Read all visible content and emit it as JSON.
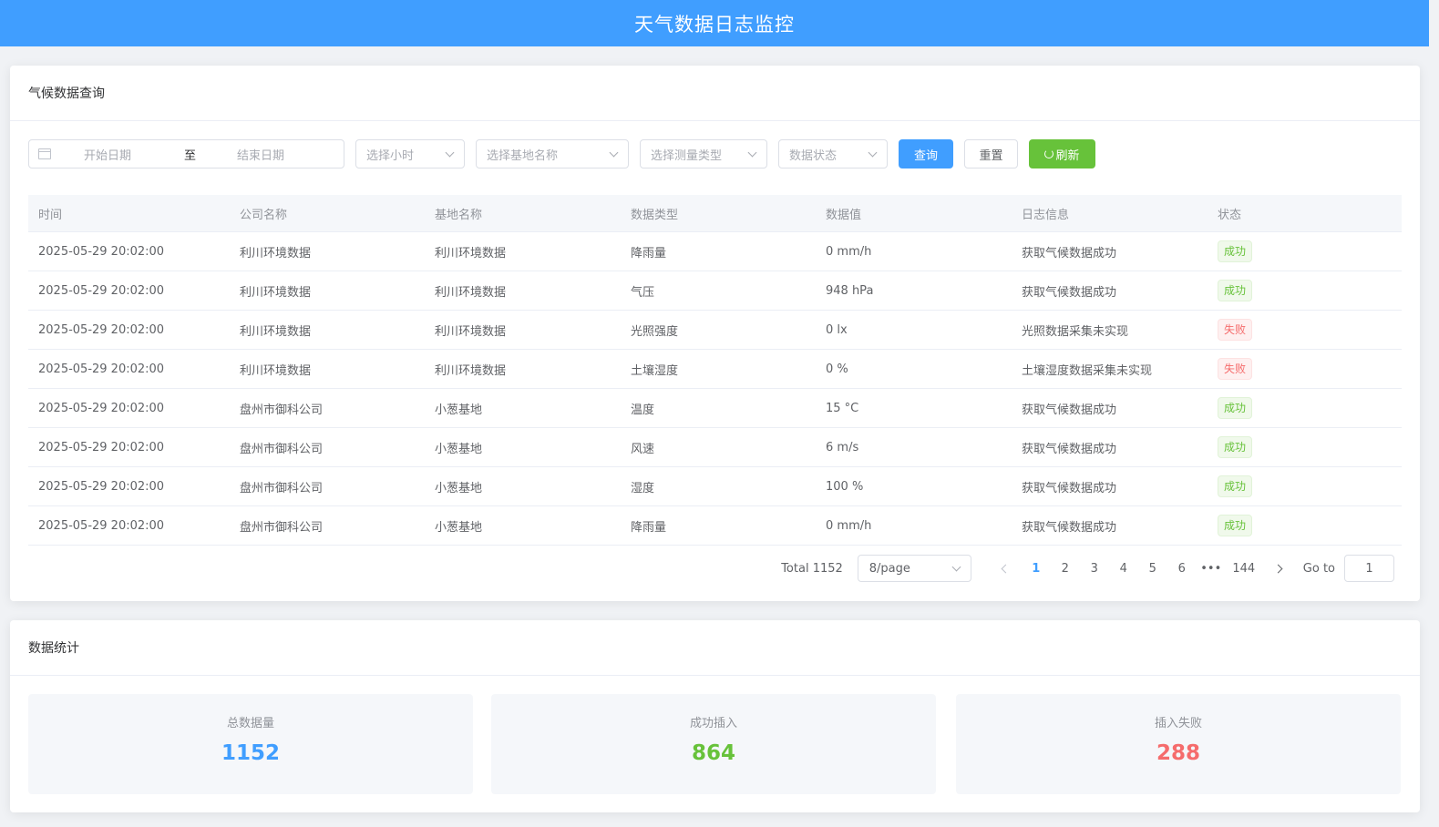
{
  "header": {
    "title": "天气数据日志监控"
  },
  "query": {
    "title": "气候数据查询",
    "filters": {
      "start_placeholder": "开始日期",
      "separator": "至",
      "end_placeholder": "结束日期",
      "hour_placeholder": "选择小时",
      "base_placeholder": "选择基地名称",
      "type_placeholder": "选择测量类型",
      "status_placeholder": "数据状态"
    },
    "buttons": {
      "query": "查询",
      "reset": "重置",
      "refresh": "刷新"
    },
    "table": {
      "headers": [
        "时间",
        "公司名称",
        "基地名称",
        "数据类型",
        "数据值",
        "日志信息",
        "状态"
      ],
      "rows": [
        [
          "2025-05-29 20:02:00",
          "利川环境数据",
          "利川环境数据",
          "降雨量",
          "0 mm/h",
          "获取气候数据成功",
          "成功"
        ],
        [
          "2025-05-29 20:02:00",
          "利川环境数据",
          "利川环境数据",
          "气压",
          "948 hPa",
          "获取气候数据成功",
          "成功"
        ],
        [
          "2025-05-29 20:02:00",
          "利川环境数据",
          "利川环境数据",
          "光照强度",
          "0 lx",
          "光照数据采集未实现",
          "失败"
        ],
        [
          "2025-05-29 20:02:00",
          "利川环境数据",
          "利川环境数据",
          "土壤湿度",
          "0 %",
          "土壤湿度数据采集未实现",
          "失败"
        ],
        [
          "2025-05-29 20:02:00",
          "盘州市御科公司",
          "小葱基地",
          "温度",
          "15 °C",
          "获取气候数据成功",
          "成功"
        ],
        [
          "2025-05-29 20:02:00",
          "盘州市御科公司",
          "小葱基地",
          "风速",
          "6 m/s",
          "获取气候数据成功",
          "成功"
        ],
        [
          "2025-05-29 20:02:00",
          "盘州市御科公司",
          "小葱基地",
          "湿度",
          "100 %",
          "获取气候数据成功",
          "成功"
        ],
        [
          "2025-05-29 20:02:00",
          "盘州市御科公司",
          "小葱基地",
          "降雨量",
          "0 mm/h",
          "获取气候数据成功",
          "成功"
        ]
      ]
    },
    "pagination": {
      "total": "Total 1152",
      "page_size": "8/page",
      "pages": [
        "1",
        "2",
        "3",
        "4",
        "5",
        "6"
      ],
      "ellipsis": "•••",
      "last_page": "144",
      "goto_label": "Go to",
      "goto_value": "1",
      "current": "1"
    }
  },
  "stats": {
    "title": "数据统计",
    "total": {
      "label": "总数据量",
      "value": "1152"
    },
    "success": {
      "label": "成功插入",
      "value": "864"
    },
    "failed": {
      "label": "插入失败",
      "value": "288"
    }
  },
  "colors": {
    "primary": "#409eff",
    "success": "#67c23a",
    "danger": "#f56c6c"
  }
}
